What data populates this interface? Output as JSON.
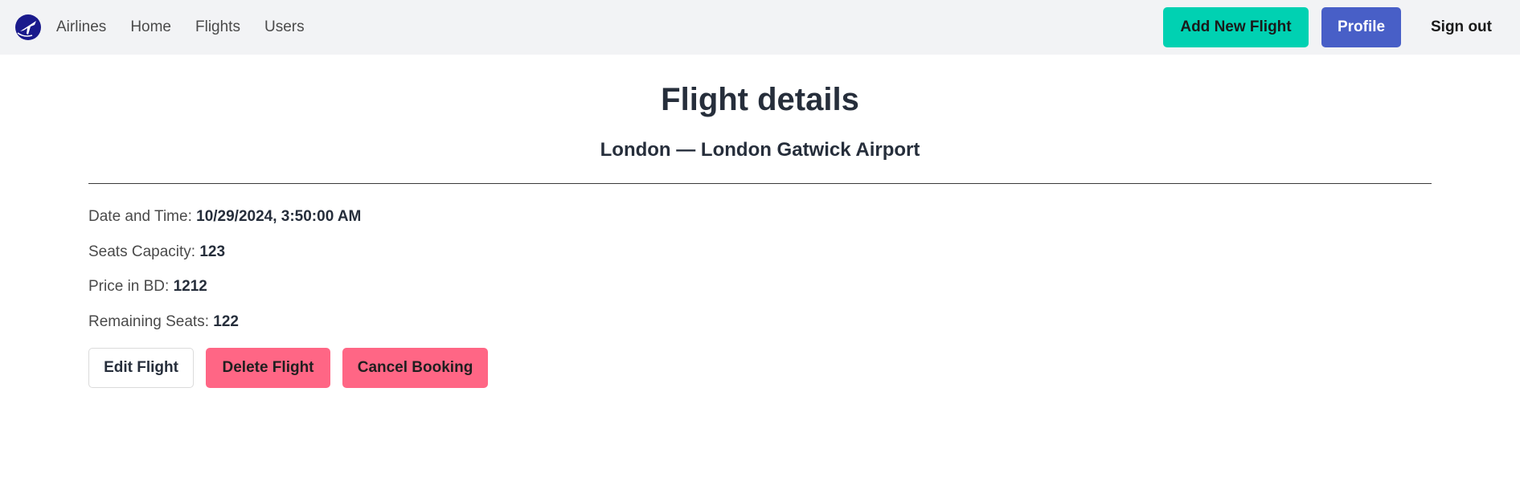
{
  "navbar": {
    "brand_icon": "airplane-logo-icon",
    "links": [
      "Airlines",
      "Home",
      "Flights",
      "Users"
    ],
    "add_flight_label": "Add New Flight",
    "profile_label": "Profile",
    "signout_label": "Sign out"
  },
  "page": {
    "title": "Flight details",
    "subtitle": "London — London Gatwick Airport"
  },
  "details": {
    "datetime_label": "Date and Time: ",
    "datetime_value": "10/29/2024, 3:50:00 AM",
    "capacity_label": "Seats Capacity: ",
    "capacity_value": "123",
    "price_label": "Price in BD: ",
    "price_value": "1212",
    "remaining_label": "Remaining Seats: ",
    "remaining_value": "122"
  },
  "actions": {
    "edit_label": "Edit Flight",
    "delete_label": "Delete Flight",
    "cancel_label": "Cancel Booking"
  },
  "colors": {
    "navbar_bg": "#f2f3f5",
    "teal": "#00d1b2",
    "indigo": "#485fc7",
    "danger": "#ff6685",
    "logo": "#1a1a8c"
  }
}
